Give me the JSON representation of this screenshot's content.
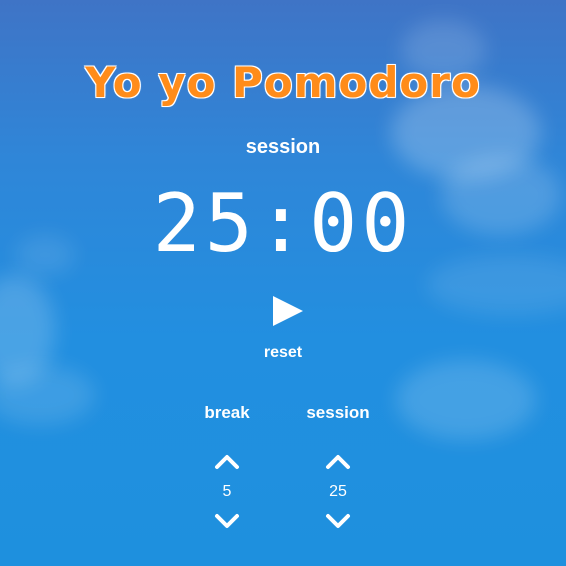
{
  "app": {
    "title": "Yo yo Pomodoro",
    "title_color": "#ff8c1a",
    "background_accent": "#228fe0"
  },
  "timer": {
    "label": "session",
    "time": "25:00",
    "play_icon": "play-icon",
    "reset_label": "reset"
  },
  "controls": {
    "break": {
      "label": "break",
      "value": "5",
      "increment_icon": "chevron-up-icon",
      "decrement_icon": "chevron-down-icon"
    },
    "session": {
      "label": "session",
      "value": "25",
      "increment_icon": "chevron-up-icon",
      "decrement_icon": "chevron-down-icon"
    }
  }
}
